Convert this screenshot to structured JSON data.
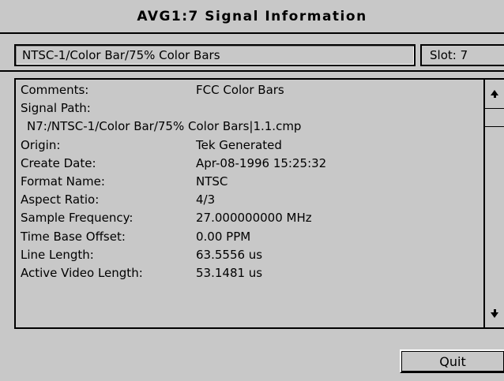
{
  "window": {
    "title": "AVG1:7  Signal Information"
  },
  "source": {
    "name": "NTSC-1/Color Bar/75%  Color Bars",
    "slot": "Slot: 7"
  },
  "details": {
    "rows": [
      {
        "label": "Comments:",
        "value": "FCC Color Bars"
      },
      {
        "label": "Signal Path:",
        "value": ""
      },
      {
        "label": "",
        "value": "N7:/NTSC-1/Color Bar/75%  Color Bars|1.1.cmp"
      },
      {
        "label": "Origin:",
        "value": "Tek Generated"
      },
      {
        "label": "Create Date:",
        "value": "Apr-08-1996  15:25:32"
      },
      {
        "label": "Format Name:",
        "value": "NTSC"
      },
      {
        "label": "Aspect Ratio:",
        "value": "4/3"
      },
      {
        "label": "Sample Frequency:",
        "value": "27.000000000 MHz"
      },
      {
        "label": "Time Base Offset:",
        "value": "0.00 PPM"
      },
      {
        "label": "Line Length:",
        "value": "63.5556 us"
      },
      {
        "label": "Active Video Length:",
        "value": "53.1481 us"
      }
    ]
  },
  "scrollbar": {
    "up_icon": "arrow-up",
    "down_icon": "arrow-down"
  },
  "actions": {
    "quit_label": "Quit"
  }
}
